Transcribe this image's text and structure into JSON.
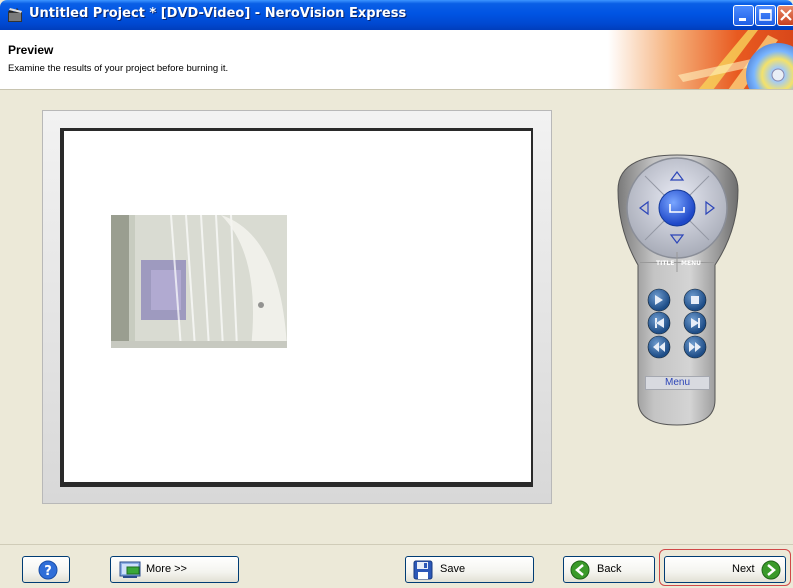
{
  "window": {
    "title": "Untitled Project * [DVD-Video] - NeroVision Express"
  },
  "header": {
    "title": "Preview",
    "subtitle": "Examine the results of your project before burning it."
  },
  "remote": {
    "title_label": "TITLE",
    "menu_label": "MENU",
    "menu_button": "Menu"
  },
  "footer": {
    "help_icon": "question-mark-icon",
    "more_label": "More >>",
    "save_label": "Save",
    "back_label": "Back",
    "next_label": "Next"
  },
  "colors": {
    "titlebar": "#0054e3",
    "accent_green": "#3a9a2a",
    "focus_ring": "#d04848"
  }
}
